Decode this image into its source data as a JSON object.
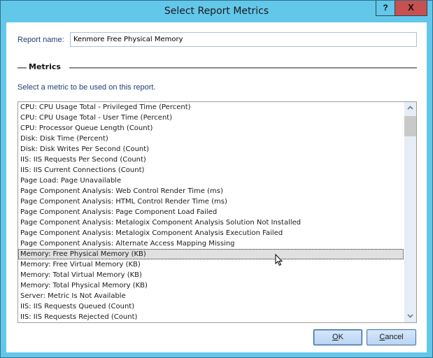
{
  "window": {
    "title": "Select Report Metrics",
    "help_label": "?",
    "close_label": "X"
  },
  "form": {
    "report_name_label": "Report name:",
    "report_name_value": "Kenmore Free Physical Memory",
    "group_title": "Metrics",
    "instruction": "Select a metric to be used on this report."
  },
  "metrics": {
    "selected_index": 14,
    "items": [
      "CPU: CPU Usage Total - Privileged Time (Percent)",
      "CPU: CPU Usage Total - User Time (Percent)",
      "CPU: Processor Queue Length (Count)",
      "Disk: Disk Time (Percent)",
      "Disk: Disk Writes Per Second (Count)",
      "IIS: IIS Requests Per Second (Count)",
      "IIS: IIS Current Connections (Count)",
      "Page Load: Page Unavailable",
      "Page Component Analysis: Web Control Render Time (ms)",
      "Page Component Analysis: HTML Control Render Time (ms)",
      "Page Component Analysis: Page Component Load Failed",
      "Page Component Analysis: Metalogix Component Analysis Solution Not Installed",
      "Page Component Analysis: Metalogix Component Analysis Execution Failed",
      "Page Component Analysis: Alternate Access Mapping Missing",
      "Memory: Free Physical Memory (KB)",
      "Memory: Free Virtual Memory (KB)",
      "Memory: Total Virtual Memory (KB)",
      "Memory: Total Physical Memory (KB)",
      "Server: Metric Is Not Available",
      "IIS: IIS Requests Queued (Count)",
      "IIS: IIS Requests Rejected (Count)"
    ]
  },
  "buttons": {
    "ok_mnemonic": "O",
    "ok_rest": "K",
    "cancel_mnemonic": "C",
    "cancel_rest": "ancel"
  },
  "icons": {
    "scroll_up": "chevron-up-icon",
    "scroll_down": "chevron-down-icon",
    "cursor": "mouse-pointer-icon"
  }
}
